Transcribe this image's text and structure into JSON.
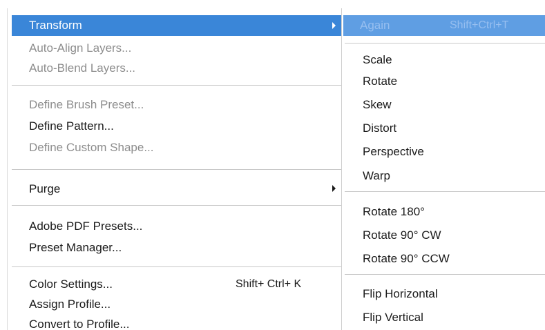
{
  "edit_menu": {
    "items": [
      {
        "label": "Transform",
        "enabled": true,
        "highlighted": true,
        "has_submenu": true
      },
      {
        "label": "Auto-Align Layers...",
        "enabled": false
      },
      {
        "label": "Auto-Blend Layers...",
        "enabled": false
      },
      {
        "label": "Define Brush Preset...",
        "enabled": false
      },
      {
        "label": "Define Pattern...",
        "enabled": true
      },
      {
        "label": "Define Custom Shape...",
        "enabled": false
      },
      {
        "label": "Purge",
        "enabled": true,
        "has_submenu": true
      },
      {
        "label": "Adobe PDF Presets...",
        "enabled": true
      },
      {
        "label": "Preset Manager...",
        "enabled": true
      },
      {
        "label": "Color Settings...",
        "enabled": true,
        "shortcut": "Shift+ Ctrl+ K"
      },
      {
        "label": "Assign Profile...",
        "enabled": true
      },
      {
        "label": "Convert to Profile...",
        "enabled": true
      }
    ]
  },
  "transform_submenu": {
    "items": [
      {
        "label": "Again",
        "shortcut": "Shift+Ctrl+T",
        "enabled": false,
        "highlighted": true
      },
      {
        "label": "Scale",
        "enabled": true
      },
      {
        "label": "Rotate",
        "enabled": true
      },
      {
        "label": "Skew",
        "enabled": true
      },
      {
        "label": "Distort",
        "enabled": true
      },
      {
        "label": "Perspective",
        "enabled": true
      },
      {
        "label": "Warp",
        "enabled": true
      },
      {
        "label": "Rotate 180°",
        "enabled": true
      },
      {
        "label": "Rotate 90° CW",
        "enabled": true
      },
      {
        "label": "Rotate 90° CCW",
        "enabled": true
      },
      {
        "label": "Flip Horizontal",
        "enabled": true
      },
      {
        "label": "Flip Vertical",
        "enabled": true
      }
    ]
  },
  "colors": {
    "highlight": "#3a86d8",
    "submenu_highlight": "#5f9ee3",
    "disabled_text": "#8d8d8d",
    "text": "#1a1a1a"
  }
}
